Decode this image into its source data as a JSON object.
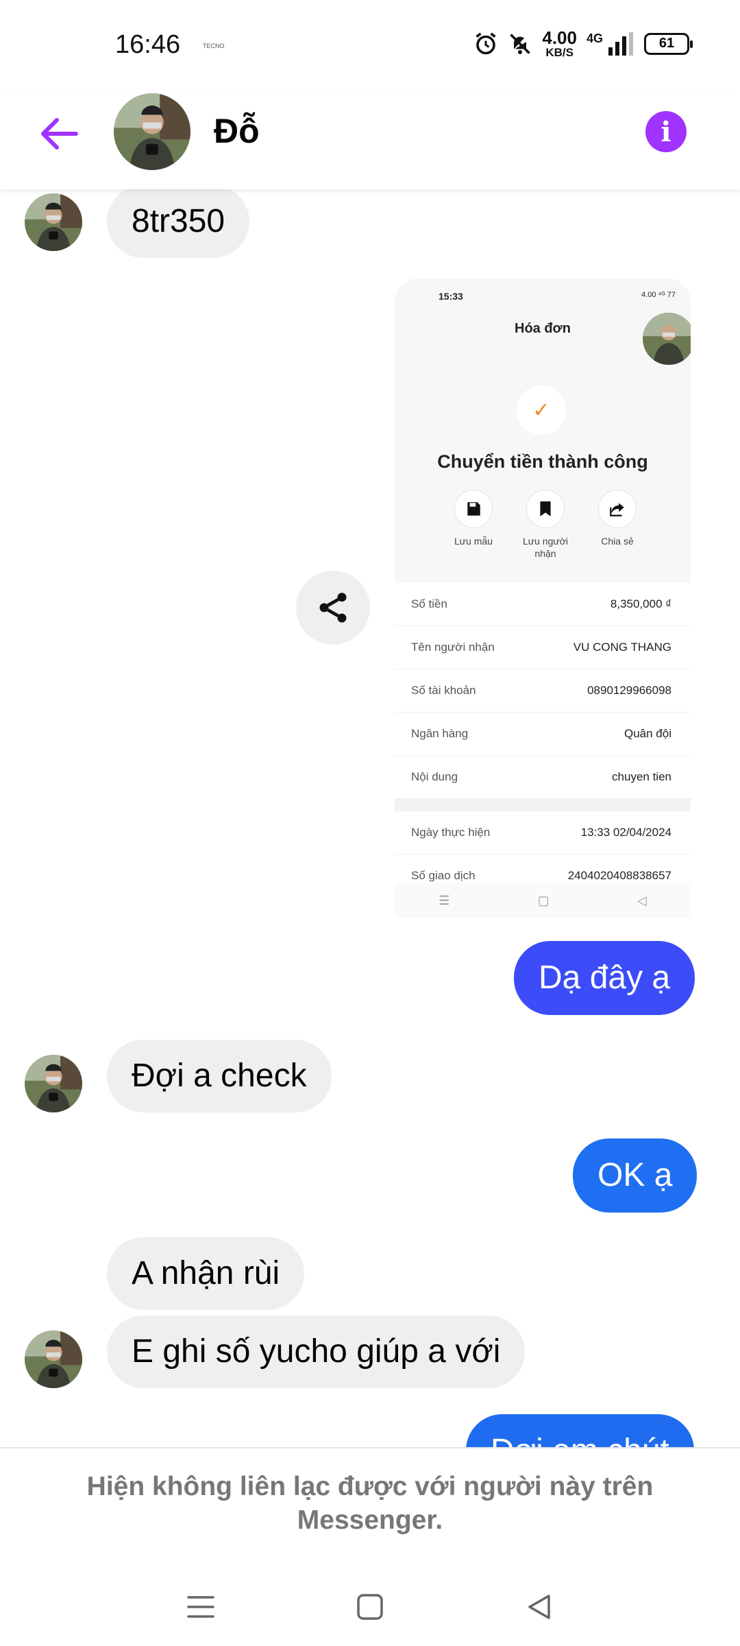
{
  "status_bar": {
    "time": "16:46",
    "tiny_label": "TECNO",
    "speed_value": "4.00",
    "speed_unit": "KB/S",
    "network": "4G",
    "battery": "61"
  },
  "header": {
    "contact_name": "Đỗ",
    "info_label": "i"
  },
  "messages": [
    {
      "side": "in",
      "text": "8tr350"
    },
    {
      "side": "out",
      "text": "Dạ đây ạ"
    },
    {
      "side": "in",
      "text": "Đợi a check"
    },
    {
      "side": "out",
      "text": "OK ạ"
    },
    {
      "side": "in",
      "text": "A nhận rùi"
    },
    {
      "side": "in",
      "text": "E ghi số yucho giúp a với"
    },
    {
      "side": "out",
      "text": "Đợi em chút"
    }
  ],
  "receipt": {
    "status_time": "15:33",
    "status_icons": "4.00 ⁴ᴳ 77",
    "title": "Hóa đơn",
    "success": "Chuyển tiền thành công",
    "actions": [
      {
        "label": "Lưu mẫu",
        "icon": "save-icon"
      },
      {
        "label": "Lưu người nhận",
        "icon": "bookmark-icon"
      },
      {
        "label": "Chia sẻ",
        "icon": "share-icon"
      }
    ],
    "rows": [
      {
        "key": "Số tiền",
        "value": "8,350,000 ₫"
      },
      {
        "key": "Tên người nhận",
        "value": "VU CONG THANG"
      },
      {
        "key": "Số tài khoản",
        "value": "0890129966098"
      },
      {
        "key": "Ngân hàng",
        "value": "Quân đội"
      },
      {
        "key": "Nội dung",
        "value": "chuyen tien"
      }
    ],
    "rows2": [
      {
        "key": "Ngày thực hiện",
        "value": "13:33 02/04/2024"
      },
      {
        "key": "Số giao dịch",
        "value": "2404020408838657"
      }
    ]
  },
  "footer": {
    "notice": "Hiện không liên lạc được với người này trên Messenger."
  },
  "colors": {
    "accent": "#a033ff",
    "outgoing_1": "#3b4cf8",
    "outgoing_2": "#1f6ff2",
    "incoming": "#efefef"
  }
}
